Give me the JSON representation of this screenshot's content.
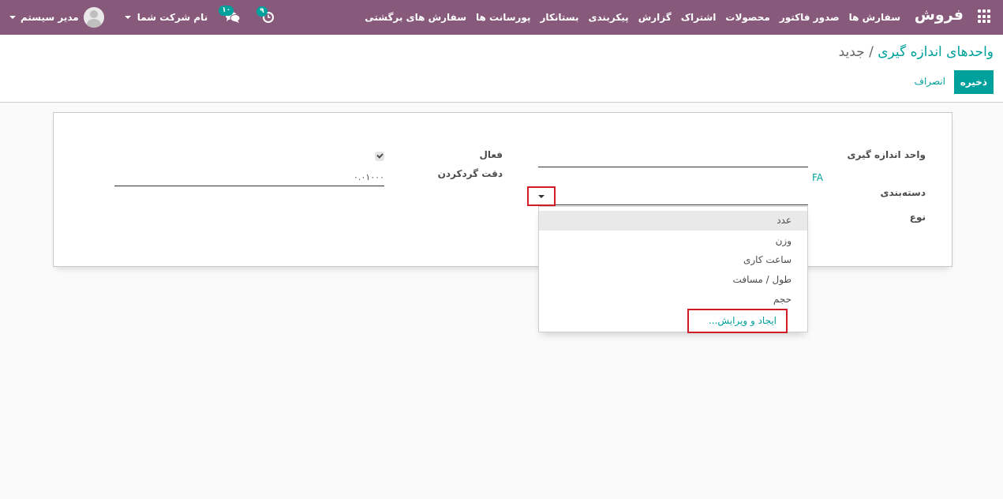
{
  "navbar": {
    "app_name": "فروش",
    "menu": [
      "سفارش ها",
      "صدور فاکتور",
      "محصولات",
      "اشتراک",
      "گزارش",
      "پیکربندی",
      "بستانکار",
      "پورسانت ها",
      "سفارش های برگشتی"
    ],
    "user_name": "مدیر سیستم",
    "company_name": "نام شرکت شما",
    "messages_badge": "۱۰",
    "activities_badge": "۹"
  },
  "breadcrumb": {
    "parent": "واحدهای اندازه گیری",
    "separator": "/",
    "current": "جدید"
  },
  "buttons": {
    "save": "ذخیره",
    "discard": "انصراف"
  },
  "form": {
    "uom_label": "واحد اندازه گیری",
    "uom_value": "",
    "fa_text": "FA",
    "category_label": "دسته‌بندی",
    "type_label": "نوع",
    "active_label": "فعال",
    "active_checked": true,
    "rounding_label": "دقت گردکردن",
    "rounding_value": "۰.۰۱۰۰۰"
  },
  "dropdown": {
    "items": [
      "عدد",
      "وزن",
      "ساعت کاری",
      "طول / مسافت",
      "حجم"
    ],
    "active_index": 0,
    "create_edit": "ایجاد و ویرایش..."
  },
  "colors": {
    "navbar": "#875a7b",
    "accent": "#00a09d",
    "highlight_border": "#d01c27"
  }
}
